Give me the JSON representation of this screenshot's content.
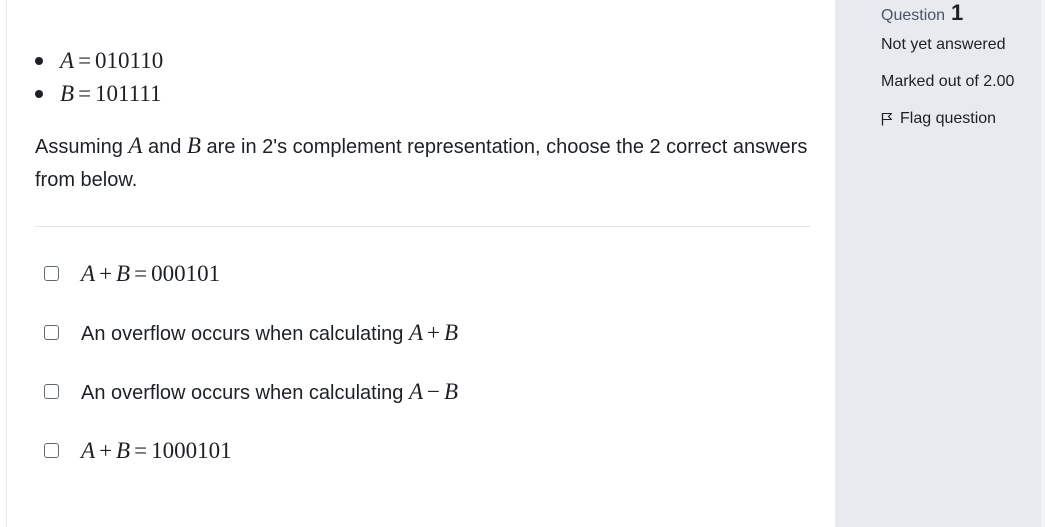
{
  "question_content": {
    "variables": [
      {
        "name": "A",
        "operator": "=",
        "value": "010110"
      },
      {
        "name": "B",
        "operator": "=",
        "value": "101111"
      }
    ],
    "prompt": {
      "part1": "Assuming ",
      "var_a": "A",
      "part2": " and ",
      "var_b": "B",
      "part3": " are in 2's complement representation, choose the 2 correct answers from below."
    },
    "answers": [
      {
        "text": "",
        "math": {
          "left": "A",
          "op": "+",
          "right": "B",
          "eq": "=",
          "result": "000101"
        },
        "checked": false
      },
      {
        "text": "An overflow occurs when calculating ",
        "math": {
          "left": "A",
          "op": "+",
          "right": "B"
        },
        "checked": false
      },
      {
        "text": "An overflow occurs when calculating ",
        "math": {
          "left": "A",
          "op": "−",
          "right": "B"
        },
        "checked": false
      },
      {
        "text": "",
        "math": {
          "left": "A",
          "op": "+",
          "right": "B",
          "eq": "=",
          "result": "1000101"
        },
        "checked": false
      }
    ]
  },
  "question_info": {
    "label": "Question",
    "number": "1",
    "state": "Not yet answered",
    "grade": "Marked out of 2.00",
    "flag_label": "Flag question",
    "flag_icon": "flag-outline-icon"
  },
  "colors": {
    "sidebar_bg": "#e7eaee",
    "text": "#1d2125",
    "muted": "#4b5563",
    "divider": "#e3e5e8",
    "checkbox_border": "#5f6b78"
  }
}
